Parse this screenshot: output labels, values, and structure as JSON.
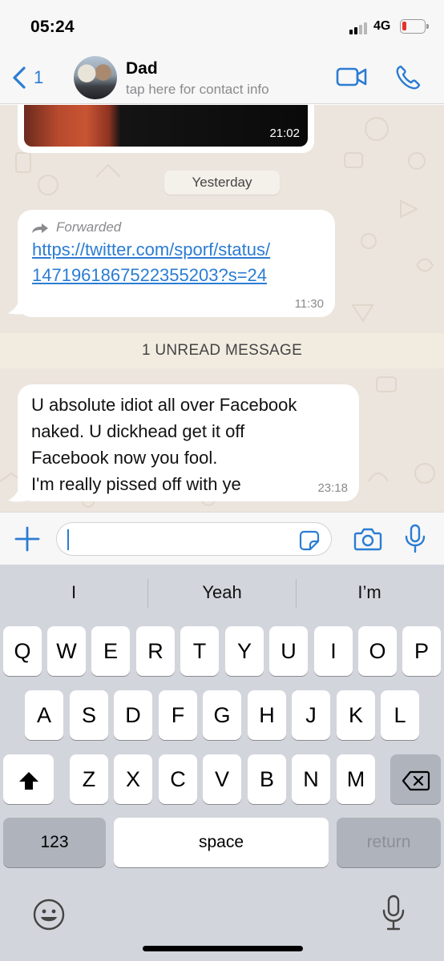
{
  "status_bar": {
    "time": "05:24",
    "network": "4G",
    "battery_color": "#e8302b"
  },
  "header": {
    "back_count": "1",
    "contact_name": "Dad",
    "contact_subtitle": "tap here for contact info",
    "accent_color": "#2b7cd3",
    "icons": [
      "chevron-left-icon",
      "video-call-icon",
      "phone-call-icon"
    ]
  },
  "chat": {
    "photo_message": {
      "time": "21:02"
    },
    "date_divider": "Yesterday",
    "forwarded_message": {
      "label": "Forwarded",
      "link_line1": "https://twitter.com/sporf/status/",
      "link_line2": "1471961867522355203?s=24",
      "time": "11:30"
    },
    "unread_divider": "1 UNREAD MESSAGE",
    "incoming_message": {
      "line1": "U absolute idiot all over Facebook",
      "line2": "naked. U dickhead get it off",
      "line3": "Facebook now you fool.",
      "line4": "I'm really pissed off with ye",
      "time": "23:18"
    }
  },
  "input_bar": {
    "value": "",
    "icons": [
      "plus-icon",
      "sticker-icon",
      "camera-icon",
      "microphone-icon"
    ]
  },
  "keyboard": {
    "suggestions": [
      "I",
      "Yeah",
      "I’m"
    ],
    "row1": [
      "Q",
      "W",
      "E",
      "R",
      "T",
      "Y",
      "U",
      "I",
      "O",
      "P"
    ],
    "row2": [
      "A",
      "S",
      "D",
      "F",
      "G",
      "H",
      "J",
      "K",
      "L"
    ],
    "row3": [
      "Z",
      "X",
      "C",
      "V",
      "B",
      "N",
      "M"
    ],
    "numbers_label": "123",
    "space_label": "space",
    "return_label": "return"
  }
}
